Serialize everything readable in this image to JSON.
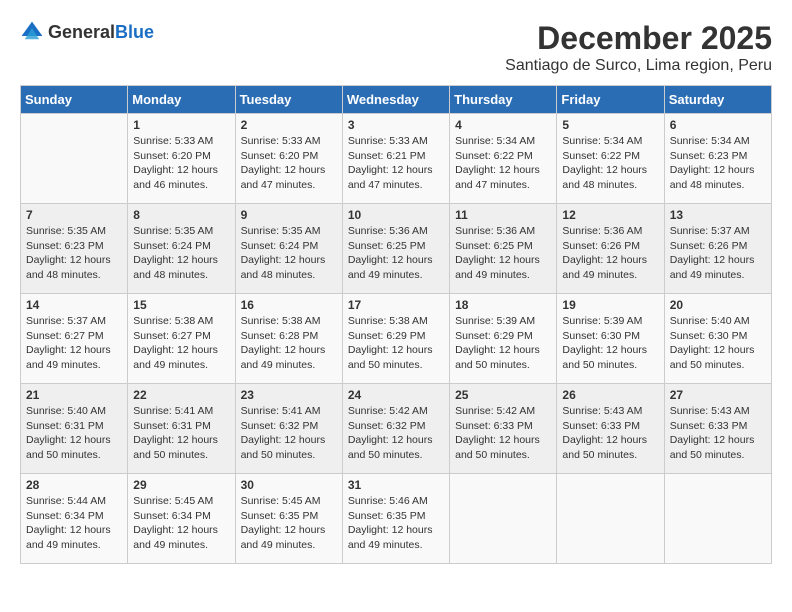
{
  "header": {
    "logo_general": "General",
    "logo_blue": "Blue",
    "month_title": "December 2025",
    "location": "Santiago de Surco, Lima region, Peru"
  },
  "weekdays": [
    "Sunday",
    "Monday",
    "Tuesday",
    "Wednesday",
    "Thursday",
    "Friday",
    "Saturday"
  ],
  "weeks": [
    [
      {
        "day": "",
        "sunrise": "",
        "sunset": "",
        "daylight": ""
      },
      {
        "day": "1",
        "sunrise": "Sunrise: 5:33 AM",
        "sunset": "Sunset: 6:20 PM",
        "daylight": "Daylight: 12 hours and 46 minutes."
      },
      {
        "day": "2",
        "sunrise": "Sunrise: 5:33 AM",
        "sunset": "Sunset: 6:20 PM",
        "daylight": "Daylight: 12 hours and 47 minutes."
      },
      {
        "day": "3",
        "sunrise": "Sunrise: 5:33 AM",
        "sunset": "Sunset: 6:21 PM",
        "daylight": "Daylight: 12 hours and 47 minutes."
      },
      {
        "day": "4",
        "sunrise": "Sunrise: 5:34 AM",
        "sunset": "Sunset: 6:22 PM",
        "daylight": "Daylight: 12 hours and 47 minutes."
      },
      {
        "day": "5",
        "sunrise": "Sunrise: 5:34 AM",
        "sunset": "Sunset: 6:22 PM",
        "daylight": "Daylight: 12 hours and 48 minutes."
      },
      {
        "day": "6",
        "sunrise": "Sunrise: 5:34 AM",
        "sunset": "Sunset: 6:23 PM",
        "daylight": "Daylight: 12 hours and 48 minutes."
      }
    ],
    [
      {
        "day": "7",
        "sunrise": "Sunrise: 5:35 AM",
        "sunset": "Sunset: 6:23 PM",
        "daylight": "Daylight: 12 hours and 48 minutes."
      },
      {
        "day": "8",
        "sunrise": "Sunrise: 5:35 AM",
        "sunset": "Sunset: 6:24 PM",
        "daylight": "Daylight: 12 hours and 48 minutes."
      },
      {
        "day": "9",
        "sunrise": "Sunrise: 5:35 AM",
        "sunset": "Sunset: 6:24 PM",
        "daylight": "Daylight: 12 hours and 48 minutes."
      },
      {
        "day": "10",
        "sunrise": "Sunrise: 5:36 AM",
        "sunset": "Sunset: 6:25 PM",
        "daylight": "Daylight: 12 hours and 49 minutes."
      },
      {
        "day": "11",
        "sunrise": "Sunrise: 5:36 AM",
        "sunset": "Sunset: 6:25 PM",
        "daylight": "Daylight: 12 hours and 49 minutes."
      },
      {
        "day": "12",
        "sunrise": "Sunrise: 5:36 AM",
        "sunset": "Sunset: 6:26 PM",
        "daylight": "Daylight: 12 hours and 49 minutes."
      },
      {
        "day": "13",
        "sunrise": "Sunrise: 5:37 AM",
        "sunset": "Sunset: 6:26 PM",
        "daylight": "Daylight: 12 hours and 49 minutes."
      }
    ],
    [
      {
        "day": "14",
        "sunrise": "Sunrise: 5:37 AM",
        "sunset": "Sunset: 6:27 PM",
        "daylight": "Daylight: 12 hours and 49 minutes."
      },
      {
        "day": "15",
        "sunrise": "Sunrise: 5:38 AM",
        "sunset": "Sunset: 6:27 PM",
        "daylight": "Daylight: 12 hours and 49 minutes."
      },
      {
        "day": "16",
        "sunrise": "Sunrise: 5:38 AM",
        "sunset": "Sunset: 6:28 PM",
        "daylight": "Daylight: 12 hours and 49 minutes."
      },
      {
        "day": "17",
        "sunrise": "Sunrise: 5:38 AM",
        "sunset": "Sunset: 6:29 PM",
        "daylight": "Daylight: 12 hours and 50 minutes."
      },
      {
        "day": "18",
        "sunrise": "Sunrise: 5:39 AM",
        "sunset": "Sunset: 6:29 PM",
        "daylight": "Daylight: 12 hours and 50 minutes."
      },
      {
        "day": "19",
        "sunrise": "Sunrise: 5:39 AM",
        "sunset": "Sunset: 6:30 PM",
        "daylight": "Daylight: 12 hours and 50 minutes."
      },
      {
        "day": "20",
        "sunrise": "Sunrise: 5:40 AM",
        "sunset": "Sunset: 6:30 PM",
        "daylight": "Daylight: 12 hours and 50 minutes."
      }
    ],
    [
      {
        "day": "21",
        "sunrise": "Sunrise: 5:40 AM",
        "sunset": "Sunset: 6:31 PM",
        "daylight": "Daylight: 12 hours and 50 minutes."
      },
      {
        "day": "22",
        "sunrise": "Sunrise: 5:41 AM",
        "sunset": "Sunset: 6:31 PM",
        "daylight": "Daylight: 12 hours and 50 minutes."
      },
      {
        "day": "23",
        "sunrise": "Sunrise: 5:41 AM",
        "sunset": "Sunset: 6:32 PM",
        "daylight": "Daylight: 12 hours and 50 minutes."
      },
      {
        "day": "24",
        "sunrise": "Sunrise: 5:42 AM",
        "sunset": "Sunset: 6:32 PM",
        "daylight": "Daylight: 12 hours and 50 minutes."
      },
      {
        "day": "25",
        "sunrise": "Sunrise: 5:42 AM",
        "sunset": "Sunset: 6:33 PM",
        "daylight": "Daylight: 12 hours and 50 minutes."
      },
      {
        "day": "26",
        "sunrise": "Sunrise: 5:43 AM",
        "sunset": "Sunset: 6:33 PM",
        "daylight": "Daylight: 12 hours and 50 minutes."
      },
      {
        "day": "27",
        "sunrise": "Sunrise: 5:43 AM",
        "sunset": "Sunset: 6:33 PM",
        "daylight": "Daylight: 12 hours and 50 minutes."
      }
    ],
    [
      {
        "day": "28",
        "sunrise": "Sunrise: 5:44 AM",
        "sunset": "Sunset: 6:34 PM",
        "daylight": "Daylight: 12 hours and 49 minutes."
      },
      {
        "day": "29",
        "sunrise": "Sunrise: 5:45 AM",
        "sunset": "Sunset: 6:34 PM",
        "daylight": "Daylight: 12 hours and 49 minutes."
      },
      {
        "day": "30",
        "sunrise": "Sunrise: 5:45 AM",
        "sunset": "Sunset: 6:35 PM",
        "daylight": "Daylight: 12 hours and 49 minutes."
      },
      {
        "day": "31",
        "sunrise": "Sunrise: 5:46 AM",
        "sunset": "Sunset: 6:35 PM",
        "daylight": "Daylight: 12 hours and 49 minutes."
      },
      {
        "day": "",
        "sunrise": "",
        "sunset": "",
        "daylight": ""
      },
      {
        "day": "",
        "sunrise": "",
        "sunset": "",
        "daylight": ""
      },
      {
        "day": "",
        "sunrise": "",
        "sunset": "",
        "daylight": ""
      }
    ]
  ]
}
